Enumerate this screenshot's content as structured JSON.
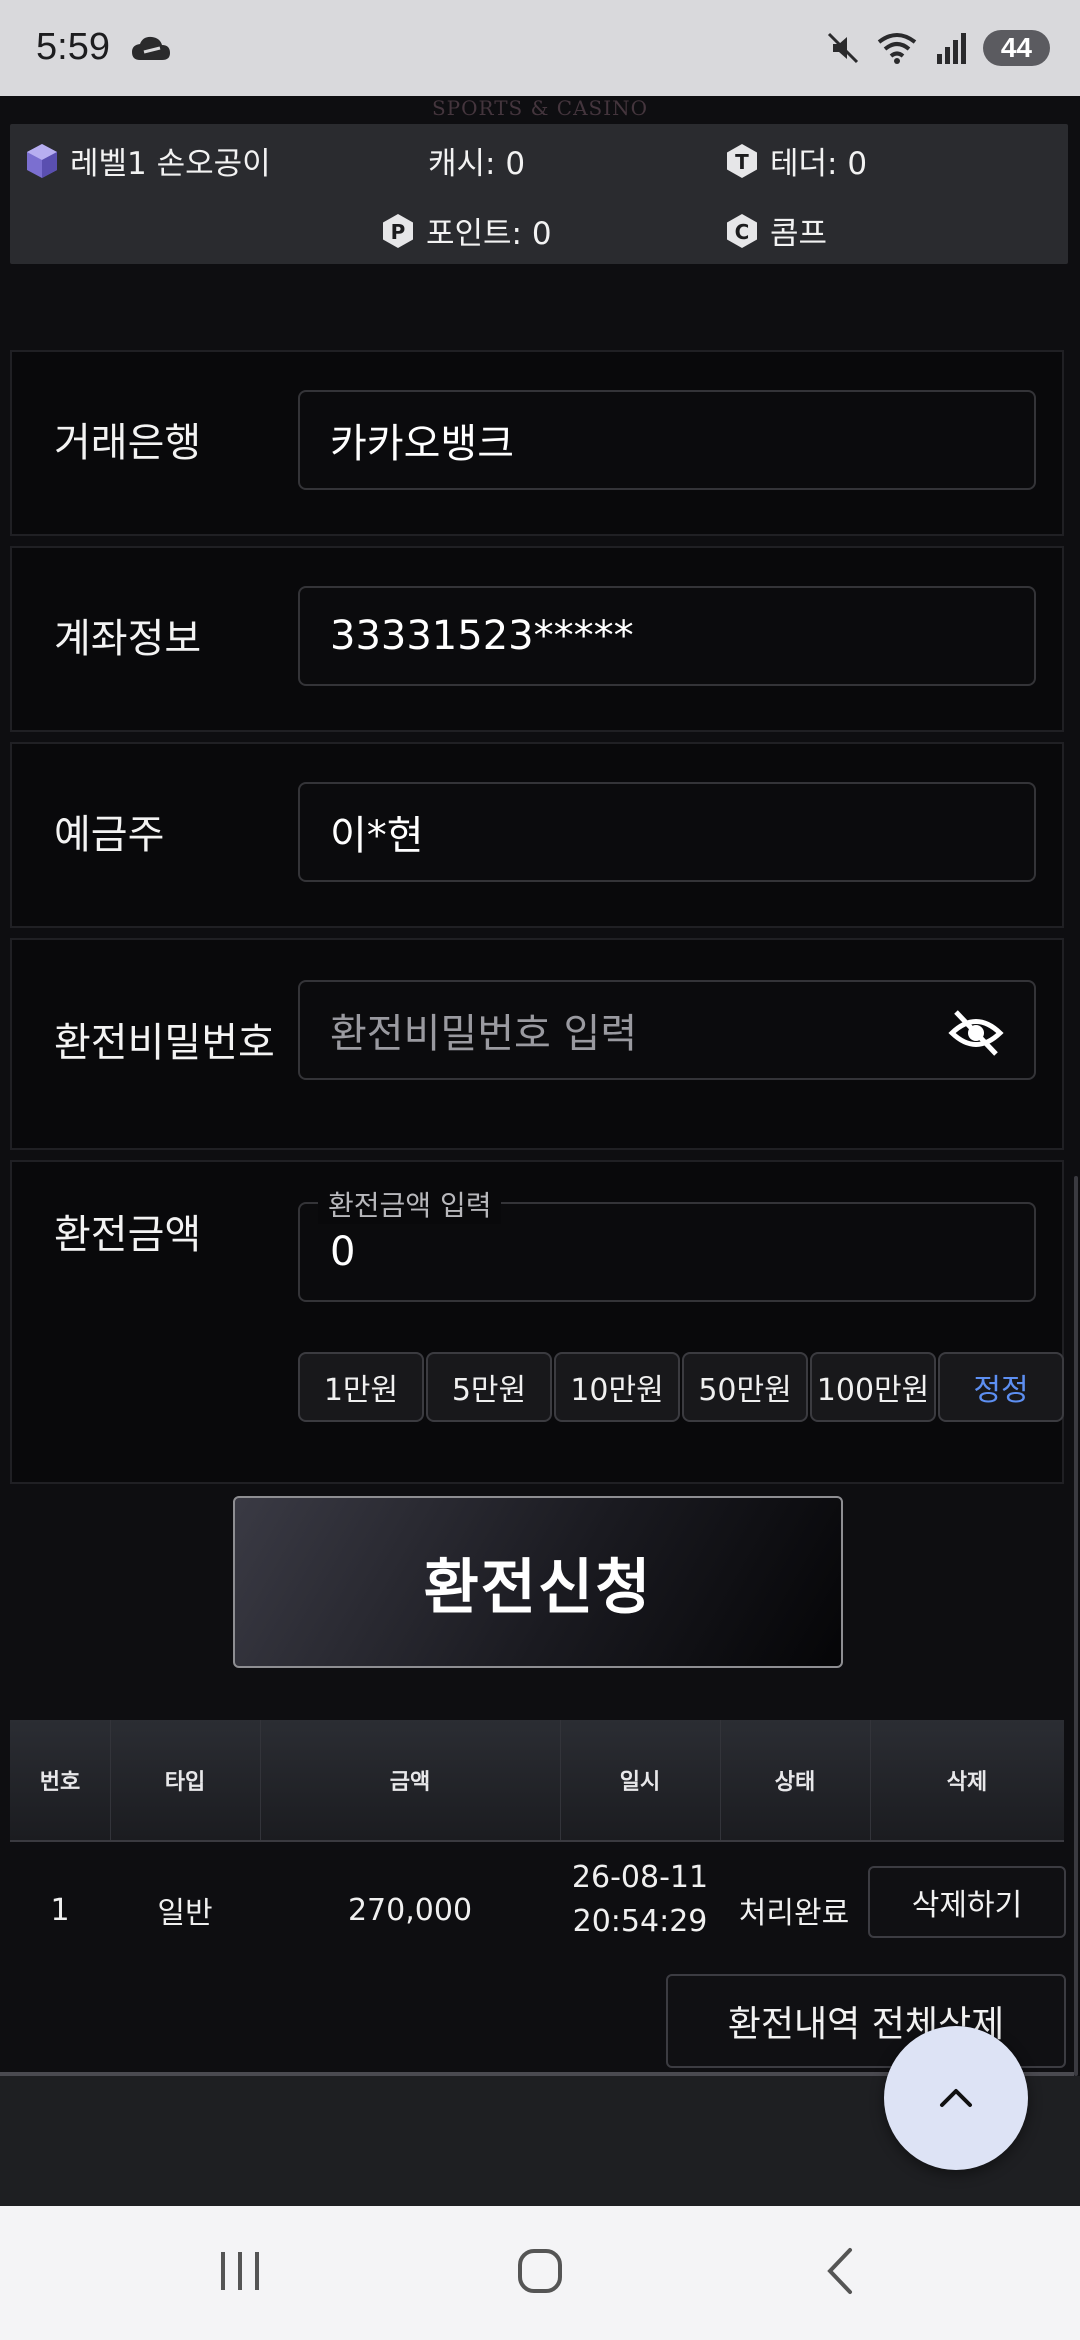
{
  "status_bar": {
    "time": "5:59",
    "battery": "44",
    "icons": [
      "cloud-icon",
      "mute-icon",
      "wifi-icon",
      "signal-icon"
    ]
  },
  "header": {
    "logo_text": "SPORTS & CASINO"
  },
  "user_info": {
    "level_name": "레벨1 손오공이",
    "cash": "캐시: 0",
    "tether": "테더: 0",
    "points": "포인트: 0",
    "comp": "콤프"
  },
  "form": {
    "bank_label": "거래은행",
    "bank_value": "카카오뱅크",
    "account_label": "계좌정보",
    "account_value": "33331523*****",
    "holder_label": "예금주",
    "holder_value": "이*현",
    "password_label": "환전비밀번호",
    "password_placeholder": "환전비밀번호 입력",
    "amount_label": "환전금액",
    "amount_float_label": "환전금액 입력",
    "amount_value": "0",
    "amount_chips": [
      "1만원",
      "5만원",
      "10만원",
      "50만원",
      "100만원"
    ],
    "correct_label": "정정",
    "submit_label": "환전신청"
  },
  "history": {
    "columns": [
      "번호",
      "타입",
      "금액",
      "일시",
      "상태",
      "삭제"
    ],
    "rows": [
      {
        "number": "1",
        "type": "일반",
        "amount": "270,000",
        "date": "26-08-11",
        "time": "20:54:29",
        "status": "처리완료",
        "delete_label": "삭제하기"
      }
    ],
    "delete_all_label": "환전내역 전체삭제"
  },
  "colors": {
    "accent_blue": "#5d8ff2",
    "background": "#0e0e11",
    "fab": "#dde3f5"
  }
}
